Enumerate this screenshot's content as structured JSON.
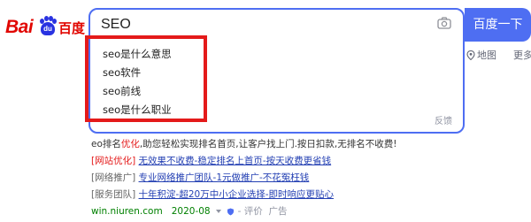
{
  "logo": {
    "bai": "Bai",
    "du": "du",
    "cn": "百度"
  },
  "search": {
    "query": "SEO",
    "button_label": "百度一下",
    "suggestions": [
      "seo是什么意思",
      "seo软件",
      "seo前线",
      "seo是什么职业"
    ],
    "feedback": "反馈"
  },
  "nav": {
    "map": "地图",
    "more": "更多"
  },
  "results": {
    "intro": {
      "prefix": "eo排名",
      "highlight": "优化",
      "rest": ",助您轻松实现排名首页,让客户找上门.按日扣款,无排名不收费!"
    },
    "ads": [
      {
        "tag": "[网站优化]",
        "tag_red": true,
        "title": "无效果不收费-稳定排名上首页-按天收费更省钱"
      },
      {
        "tag": "[网络推广]",
        "tag_red": false,
        "title": "专业网络推广团队-1元做推广-不花冤枉钱"
      },
      {
        "tag": "[服务团队]",
        "tag_red": false,
        "title": "十年积淀-超20万中小企业选择-即时响应更贴心"
      }
    ],
    "footer": {
      "url": "win.niuren.com",
      "date": "2020-08",
      "review": "评价",
      "ad": "广告"
    }
  },
  "colors": {
    "brand_blue": "#4e6ef2",
    "logo_red": "#e10601",
    "annotation_red": "#e41a1a",
    "link_blue": "#2440b3",
    "url_green": "#008000"
  }
}
